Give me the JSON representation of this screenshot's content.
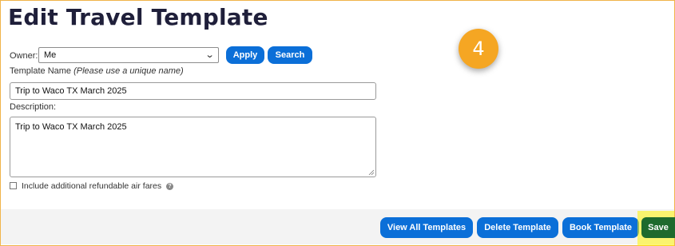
{
  "page": {
    "title": "Edit Travel Template",
    "step_badge": "4"
  },
  "form": {
    "owner_label": "Owner:",
    "owner_value": "Me",
    "apply_label": "Apply",
    "search_label": "Search",
    "template_name_label": "Template Name",
    "template_name_hint": "(Please use a unique name)",
    "template_name_value": "Trip to Waco TX  March 2025",
    "description_label": "Description:",
    "description_value": "Trip to Waco TX  March 2025",
    "refundable_label": "Include additional refundable air fares",
    "refundable_checked": false
  },
  "footer": {
    "view_all_label": "View All Templates",
    "delete_label": "Delete Template",
    "book_label": "Book Template",
    "save_label": "Save"
  },
  "colors": {
    "primary_button": "#0b6fd8",
    "save_button": "#1e6a2d",
    "highlight": "#fff200",
    "step_badge": "#f5a623",
    "frame_border": "#f0b44a"
  }
}
